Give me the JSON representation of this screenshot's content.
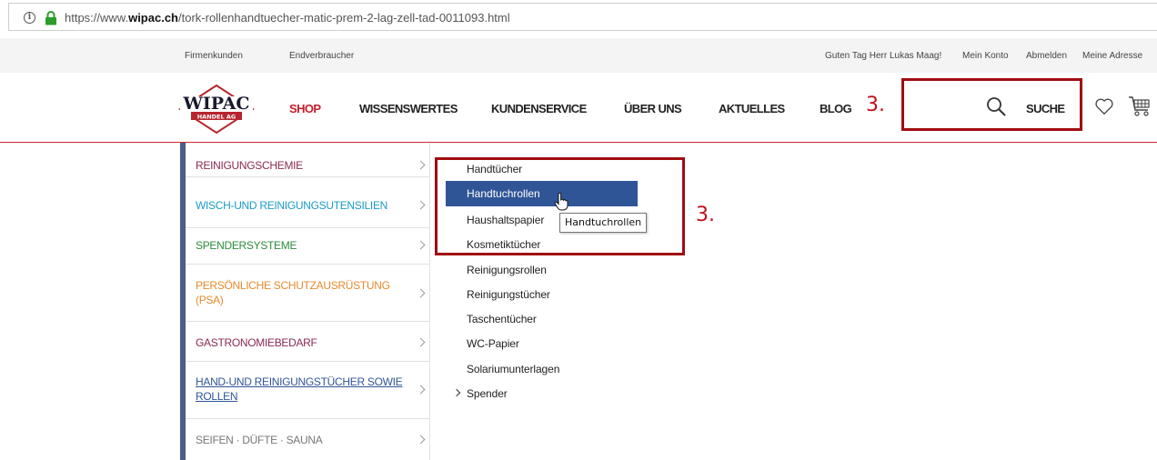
{
  "browser": {
    "url_prefix": "https://www.",
    "url_domain": "wipac.ch",
    "url_path": "/tork-rollenhandtuecher-matic-prem-2-lag-zell-tad-0011093.html",
    "info_icon": "i"
  },
  "utility_bar": {
    "left_links": [
      "Firmenkunden",
      "Endverbraucher"
    ],
    "right_links": [
      "Guten Tag Herr Lukas Maag!",
      "Mein Konto",
      "Abmelden",
      "Meine Adresse"
    ]
  },
  "header": {
    "logo_text": "WIPAC",
    "logo_subtext": "HANDEL AG",
    "nav": [
      "SHOP",
      "WISSENSWERTES",
      "KUNDENSERVICE",
      "ÜBER UNS",
      "AKTUELLES",
      "BLOG"
    ],
    "search_label": "SUCHE",
    "accent_color": "#c41e2a"
  },
  "annotations": {
    "number_search": "3.",
    "number_menu": "3.",
    "color": "#a00c12"
  },
  "categories": [
    {
      "label": "REINIGUNGSCHEMIE",
      "color": "#8a2a55"
    },
    {
      "label": "WISCH-UND REINIGUNGSUTENSILIEN",
      "color": "#1b9bc5"
    },
    {
      "label": "SPENDERSYSTEME",
      "color": "#2d8c3c"
    },
    {
      "label": "PERSÖNLICHE SCHUTZAUSRÜSTUNG (PSA)",
      "color": "#e88a2e"
    },
    {
      "label": "GASTRONOMIEBEDARF",
      "color": "#8a2a55"
    },
    {
      "label": "HAND-UND REINIGUNGSTÜCHER SOWIE ROLLEN",
      "color": "#2f5597"
    },
    {
      "label": "SEIFEN · DÜFTE · SAUNA",
      "color": "#777777"
    }
  ],
  "subcategories": {
    "items": [
      "Handtücher",
      "Handtuchrollen",
      "Haushaltspapier",
      "Kosmetiktücher",
      "Reinigungsrollen",
      "Reinigungstücher",
      "Taschentücher",
      "WC-Papier",
      "Solariumunterlagen",
      "Spender"
    ],
    "highlighted": "Handtuchrollen",
    "tooltip": "Handtuchrollen"
  }
}
